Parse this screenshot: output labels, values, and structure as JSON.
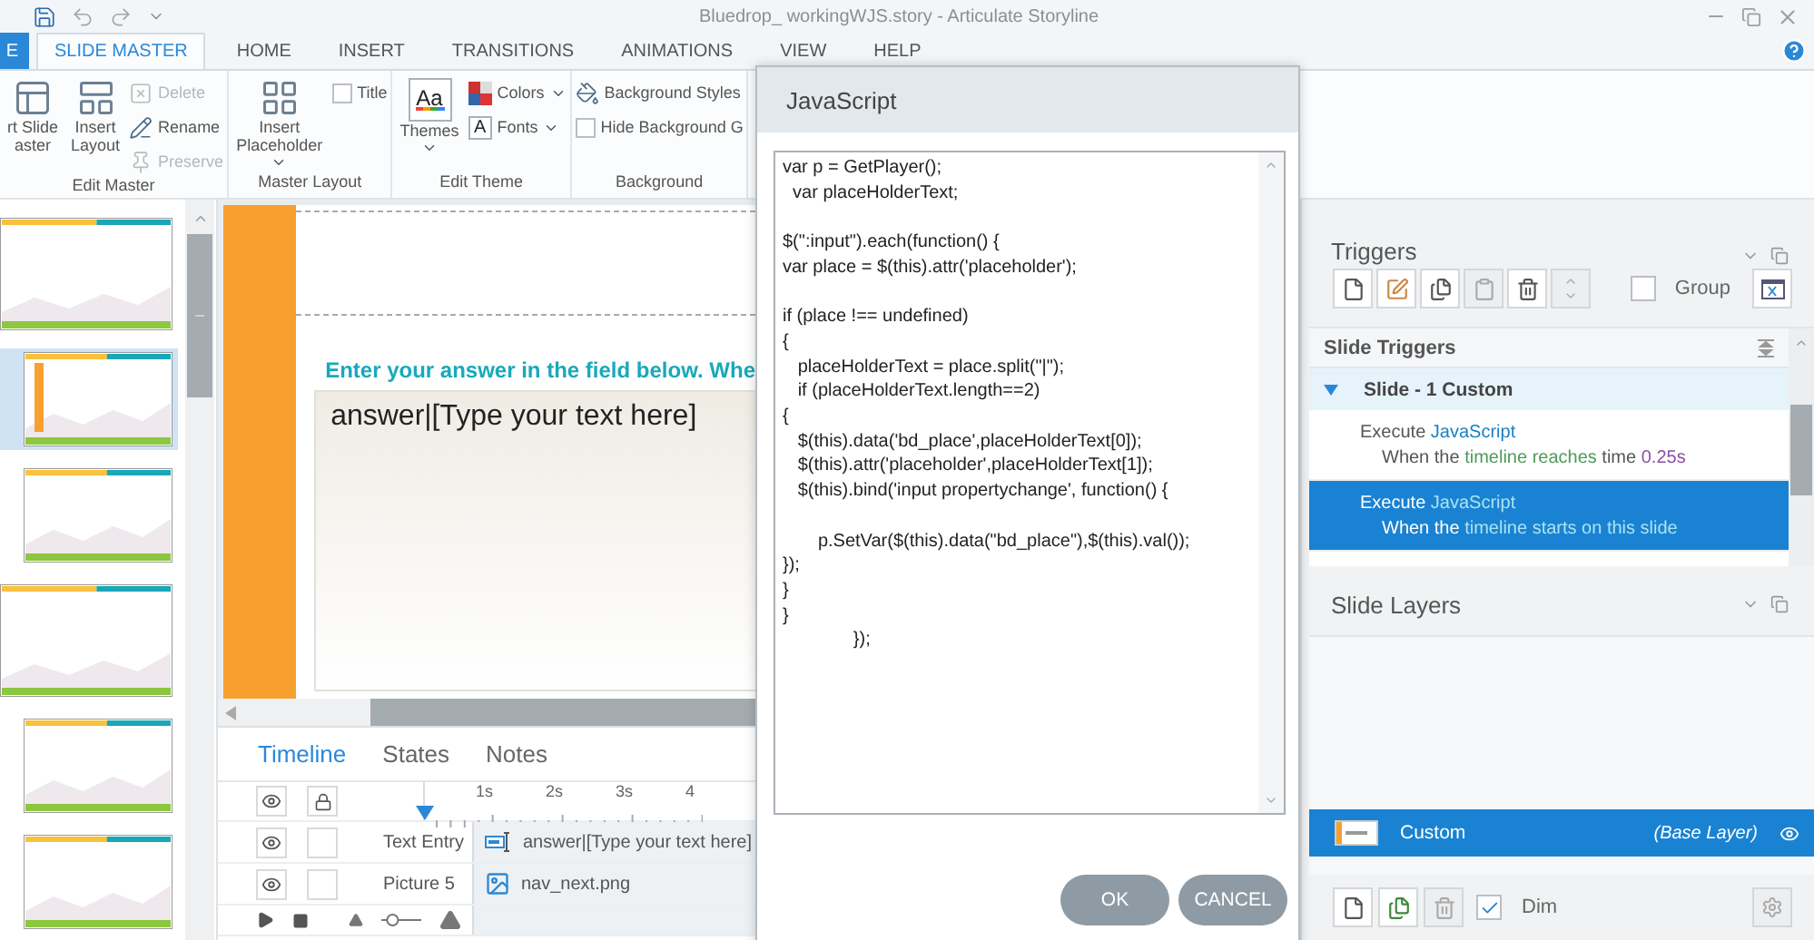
{
  "window": {
    "title": "Bluedrop_ workingWJS.story -  Articulate Storyline"
  },
  "ribbon_tabs": [
    {
      "label": "E",
      "selected": false,
      "kind": "file"
    },
    {
      "label": "SLIDE MASTER",
      "selected": true,
      "kind": "tab"
    },
    {
      "label": "HOME",
      "selected": false,
      "kind": "tab"
    },
    {
      "label": "INSERT",
      "selected": false,
      "kind": "tab"
    },
    {
      "label": "TRANSITIONS",
      "selected": false,
      "kind": "tab"
    },
    {
      "label": "ANIMATIONS",
      "selected": false,
      "kind": "tab"
    },
    {
      "label": "VIEW",
      "selected": false,
      "kind": "tab"
    },
    {
      "label": "HELP",
      "selected": false,
      "kind": "tab"
    }
  ],
  "ribbon_groups": [
    {
      "label": "Edit Master",
      "items": [
        {
          "kind": "large",
          "lines": [
            "rt Slide",
            "aster"
          ],
          "dropdown": false
        },
        {
          "kind": "large",
          "lines": [
            "Insert",
            "Layout"
          ],
          "dropdown": false
        },
        {
          "kind": "stack",
          "entries": [
            {
              "kind": "small",
              "label": "Delete",
              "disabled": true
            },
            {
              "kind": "small",
              "label": "Rename",
              "disabled": false
            },
            {
              "kind": "small",
              "label": "Preserve",
              "disabled": true
            }
          ]
        }
      ]
    },
    {
      "label": "Master Layout",
      "items": [
        {
          "kind": "large",
          "lines": [
            "Insert",
            "Placeholder"
          ],
          "dropdown": true
        },
        {
          "kind": "stack",
          "entries": [
            {
              "kind": "check",
              "label": "Title",
              "checked": false
            }
          ]
        }
      ]
    },
    {
      "label": "Edit Theme",
      "items": [
        {
          "kind": "large",
          "lines": [
            "Themes"
          ],
          "glyph": "Aa",
          "dropdown": true
        },
        {
          "kind": "stack",
          "entries": [
            {
              "kind": "small",
              "label": "Colors",
              "disabled": false,
              "dropdown": true
            },
            {
              "kind": "small",
              "label": "Fonts",
              "glyph": "A",
              "disabled": false,
              "dropdown": true
            }
          ]
        }
      ]
    },
    {
      "label": "Background",
      "items": [
        {
          "kind": "stack",
          "entries": [
            {
              "kind": "small",
              "label": "Background Styles",
              "disabled": false
            },
            {
              "kind": "check",
              "label": "Hide Background G",
              "checked": false
            }
          ]
        }
      ]
    }
  ],
  "thumbnails": [
    {
      "kind": "master",
      "selected": false
    },
    {
      "kind": "layout",
      "selected": true
    },
    {
      "kind": "layout",
      "selected": false
    },
    {
      "kind": "master",
      "selected": false
    },
    {
      "kind": "layout",
      "selected": false
    },
    {
      "kind": "layout",
      "selected": false
    }
  ],
  "slide": {
    "instruction": "Enter your answer in the field below. Whe",
    "text_entry": "answer|[Type your text here]"
  },
  "timeline": {
    "tabs": [
      {
        "label": "Timeline",
        "selected": true
      },
      {
        "label": "States",
        "selected": false
      },
      {
        "label": "Notes",
        "selected": false
      }
    ],
    "ruler": [
      "1s",
      "2s",
      "3s",
      "4"
    ],
    "zoom": {
      "level": 0.2
    },
    "rows": [
      {
        "kind": "text-entry",
        "name": "Text Entry",
        "visible": true,
        "locked": false,
        "bar_label": "answer|[Type your text here]"
      },
      {
        "kind": "picture",
        "name": "Picture 5",
        "visible": true,
        "locked": false,
        "bar_label": "nav_next.png"
      }
    ]
  },
  "dialog": {
    "title": "JavaScript",
    "code": "var p = GetPlayer();\n  var placeHolderText;\n\n$(\":input\").each(function() {\nvar place = $(this).attr('placeholder');\n\nif (place !== undefined)\n{\n   placeHolderText = place.split(\"|\");\n   if (placeHolderText.length==2)\n{\n   $(this).data('bd_place',placeHolderText[0]);\n   $(this).attr('placeholder',placeHolderText[1]);\n   $(this).bind('input propertychange', function() {\n\n       p.SetVar($(this).data(\"bd_place\"),$(this).val());\n});\n}\n}\n              });",
    "buttons": [
      "OK",
      "CANCEL"
    ]
  },
  "triggers": {
    "title": "Triggers",
    "group_toggle": {
      "label": "Group",
      "checked": false
    },
    "section_title": "Slide Triggers",
    "groups": [
      {
        "label": "Slide - 1 Custom",
        "expanded": true,
        "triggers": [
          {
            "selected": false,
            "action": [
              {
                "text": "Execute ",
                "kind": "plain"
              },
              {
                "text": "JavaScript",
                "kind": "action"
              }
            ],
            "condition": [
              {
                "text": "When the ",
                "kind": "plain"
              },
              {
                "text": "timeline reaches",
                "kind": "keyword"
              },
              {
                "text": " time ",
                "kind": "plain"
              },
              {
                "text": "0.25s",
                "kind": "value"
              }
            ]
          },
          {
            "selected": true,
            "action": [
              {
                "text": "Execute ",
                "kind": "plain"
              },
              {
                "text": "JavaScript",
                "kind": "action"
              }
            ],
            "condition": [
              {
                "text": "When the ",
                "kind": "plain"
              },
              {
                "text": "timeline starts on this slide",
                "kind": "keyword"
              }
            ]
          }
        ]
      }
    ]
  },
  "layers": {
    "title": "Slide Layers",
    "items": [
      {
        "name": "Custom",
        "note": "(Base Layer)",
        "selected": true,
        "visible": true
      }
    ],
    "dim": {
      "label": "Dim",
      "checked": true
    }
  }
}
